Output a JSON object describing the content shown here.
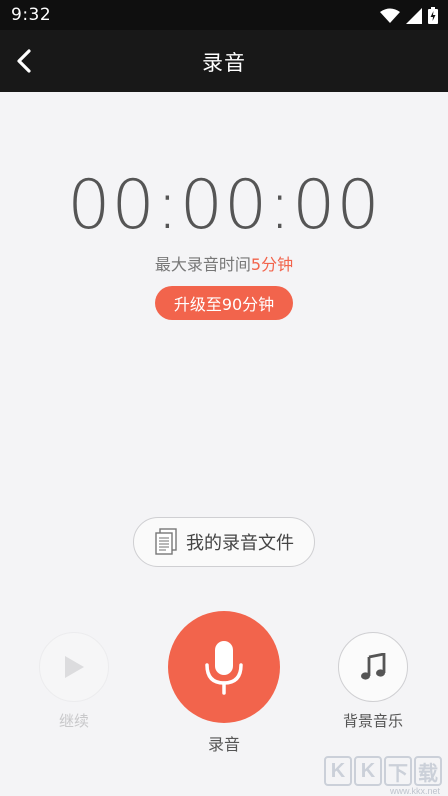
{
  "status_bar": {
    "time": "9:32",
    "icons": [
      "wifi-icon",
      "signal-icon",
      "battery-icon"
    ]
  },
  "app_bar": {
    "title": "录音",
    "back_icon": "chevron-left-icon"
  },
  "timer": {
    "display": "00:00:00"
  },
  "limit": {
    "prefix": "最大录音时间",
    "highlight": "5分钟",
    "highlight_color": "#f2644c"
  },
  "upgrade": {
    "label": "升级至90分钟"
  },
  "files": {
    "label": "我的录音文件",
    "icon": "document-icon"
  },
  "controls": {
    "continue": {
      "label": "继续",
      "icon": "play-icon",
      "enabled": false
    },
    "record": {
      "label": "录音",
      "icon": "microphone-icon"
    },
    "music": {
      "label": "背景音乐",
      "icon": "music-note-icon"
    }
  },
  "watermark": {
    "letters": [
      "K",
      "K",
      "下",
      "载"
    ],
    "url": "www.kkx.net"
  },
  "colors": {
    "accent": "#f2644c",
    "app_bar": "#181818",
    "background": "#f4f4f6"
  }
}
